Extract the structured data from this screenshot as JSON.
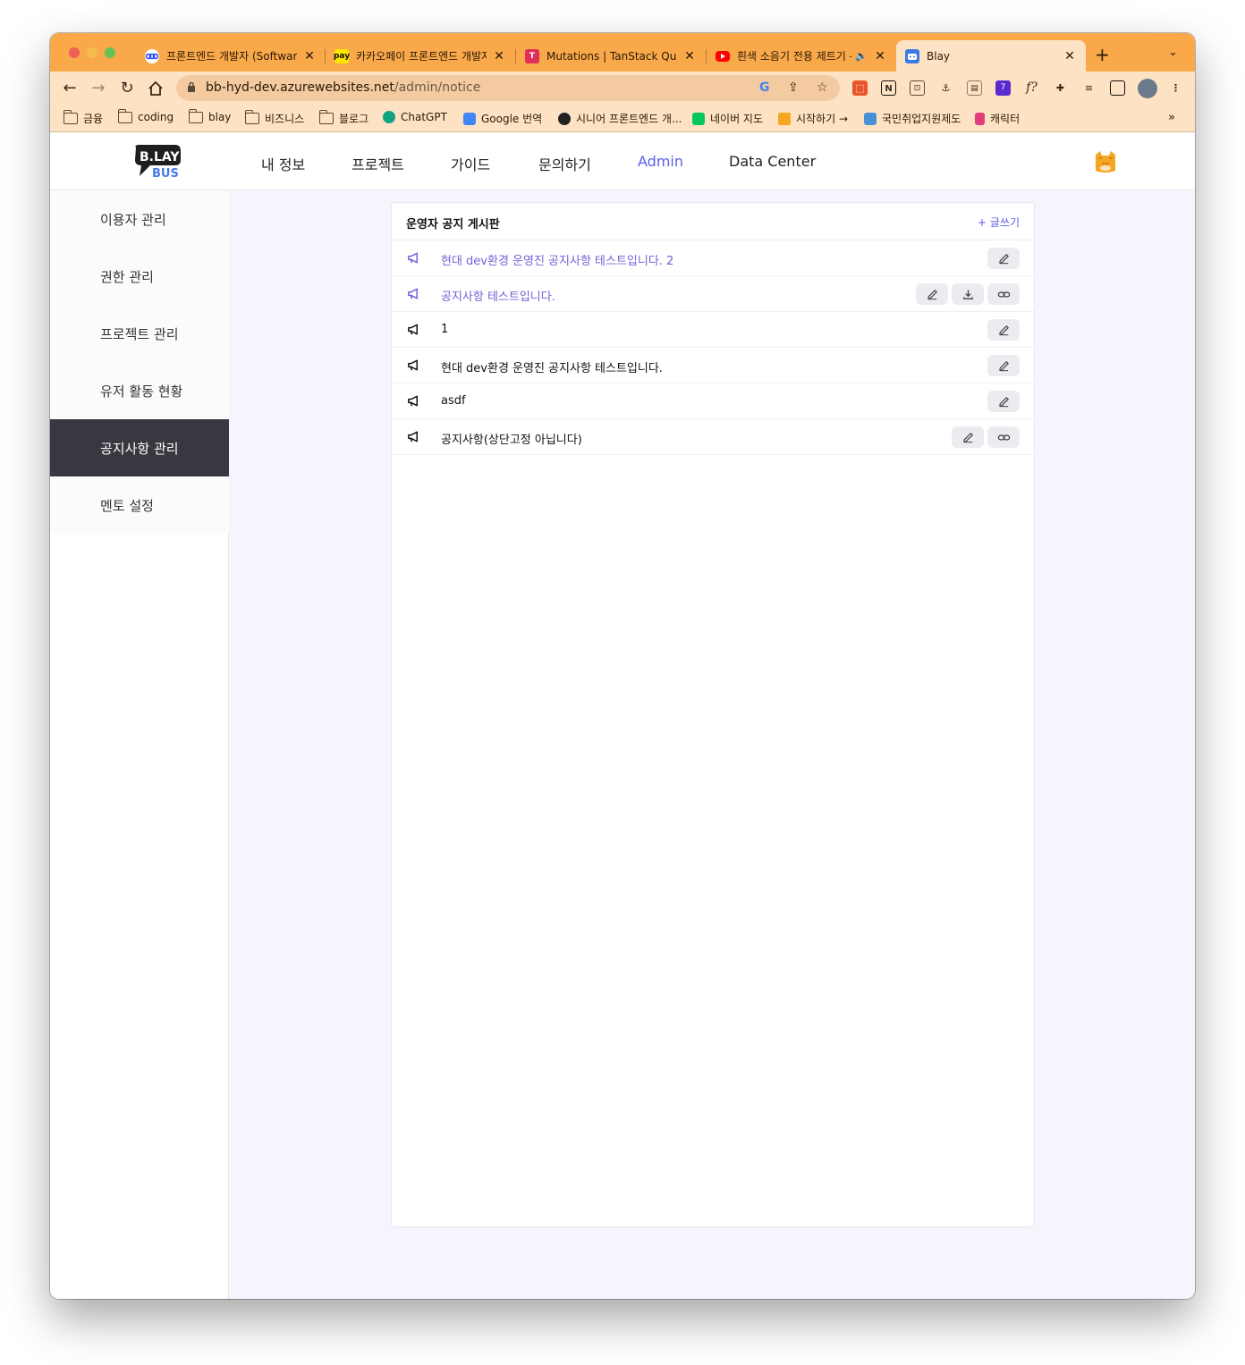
{
  "browser": {
    "tabs": [
      {
        "title": "프론트엔드 개발자 (Software",
        "favicon": "wavve-icon",
        "fav_color": "#1a3cff"
      },
      {
        "title": "카카오페이 프론트엔드 개발자",
        "favicon": "kakaopay-icon",
        "fav_color": "#ffe600",
        "fav_text": "pay"
      },
      {
        "title": "Mutations | TanStack Quer",
        "favicon": "tanstack-icon",
        "fav_color": "#e02d5a",
        "fav_text": "T"
      },
      {
        "title": "흰색 소음기 전용 제트기 -",
        "favicon": "youtube-icon",
        "fav_color": "#ff0000"
      },
      {
        "title": "Blay",
        "favicon": "blay-icon",
        "fav_color": "#3a7be8"
      }
    ],
    "url_host": "bb-hyd-dev.azurewebsites.net",
    "url_path": "/admin/notice",
    "bookmarks": [
      {
        "label": "금융",
        "type": "folder"
      },
      {
        "label": "coding",
        "type": "folder"
      },
      {
        "label": "blay",
        "type": "folder"
      },
      {
        "label": "비즈니스",
        "type": "folder"
      },
      {
        "label": "블로그",
        "type": "folder"
      },
      {
        "label": "ChatGPT",
        "type": "site",
        "color": "#10a37f"
      },
      {
        "label": "Google 번역",
        "type": "site",
        "color": "#4285f4"
      },
      {
        "label": "시니어 프론트엔드 개...",
        "type": "site",
        "color": "#222222"
      },
      {
        "label": "네이버 지도",
        "type": "site",
        "color": "#03c75a"
      },
      {
        "label": "시작하기 →",
        "type": "site",
        "color": "#f5a623"
      },
      {
        "label": "국민취업지원제도",
        "type": "site",
        "color": "#4a90d9"
      },
      {
        "label": "캐릭터",
        "type": "site",
        "color": "#e23d7a"
      }
    ],
    "more_bookmarks": "»"
  },
  "topnav": {
    "logo_text_top": "B.LAY",
    "logo_text_bottom": "BUS",
    "links": [
      "내 정보",
      "프로젝트",
      "가이드",
      "문의하기",
      "Admin",
      "Data Center"
    ],
    "active_link": "Admin"
  },
  "sidebar": {
    "items": [
      "이용자 관리",
      "권한 관리",
      "프로젝트 관리",
      "유저 활동 현황",
      "공지사항 관리",
      "멘토 설정"
    ],
    "active_item": "공지사항 관리"
  },
  "board": {
    "title": "운영자 공지 게시판",
    "write_label": "+ 글쓰기",
    "rows": [
      {
        "text": "현대 dev환경 운영진 공지사항 테스트입니다. 2",
        "pinned": true,
        "actions": [
          "edit"
        ]
      },
      {
        "text": "공지사항 테스트입니다.",
        "pinned": true,
        "actions": [
          "edit",
          "download",
          "link"
        ]
      },
      {
        "text": "1",
        "pinned": false,
        "actions": [
          "edit"
        ]
      },
      {
        "text": "현대 dev환경 운영진 공지사항 테스트입니다.",
        "pinned": false,
        "actions": [
          "edit"
        ]
      },
      {
        "text": "asdf",
        "pinned": false,
        "actions": [
          "edit"
        ]
      },
      {
        "text": "공지사항(상단고정 아닙니다)",
        "pinned": false,
        "actions": [
          "edit",
          "link"
        ]
      }
    ]
  },
  "colors": {
    "accent": "#5b5ee6",
    "pinned_text": "#6f63d8",
    "sidebar_active_bg": "#383840",
    "tabstrip": "#f9a84a",
    "toolbar": "#fde3c3"
  }
}
